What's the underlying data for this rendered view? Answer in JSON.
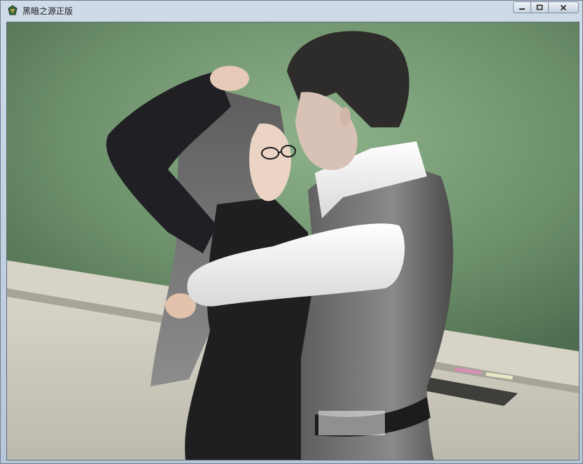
{
  "window": {
    "title": "黑暗之源正版"
  },
  "controls": {
    "minimize": "minimize",
    "maximize": "maximize",
    "close": "close"
  },
  "icons": {
    "app": "app-icon",
    "minimize": "minimize-icon",
    "maximize": "maximize-icon",
    "close": "close-icon"
  },
  "scene": {
    "description_icon": "game-scene"
  }
}
